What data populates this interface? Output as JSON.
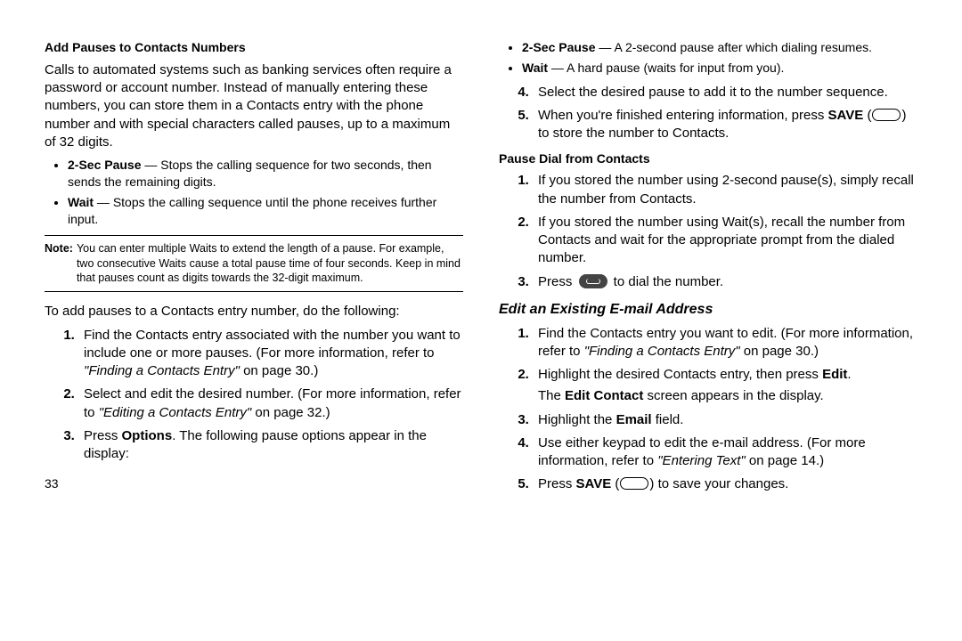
{
  "left": {
    "h1": "Add Pauses to Contacts Numbers",
    "intro": "Calls to automated systems such as banking services often require a password or account number. Instead of manually entering these numbers, you can store them in a Contacts entry with the phone number and with special characters called pauses, up to a maximum of 32 digits.",
    "bullets": [
      {
        "label": "2-Sec Pause",
        "text": " — Stops the calling sequence for two seconds, then sends the remaining digits."
      },
      {
        "label": "Wait",
        "text": " — Stops the calling sequence until the phone receives further input."
      }
    ],
    "note_label": "Note:",
    "note_text": "You can enter multiple Waits to extend the length of a pause. For example, two consecutive Waits cause a total pause time of four seconds. Keep in mind that pauses count as digits towards the 32-digit maximum.",
    "lead": "To add pauses to a Contacts entry number, do the following:",
    "steps": {
      "s1a": "Find the Contacts entry associated with the number you want to include one or more pauses. (For more information, refer to ",
      "s1ref": "\"Finding a Contacts Entry\"",
      "s1b": " on page 30.)",
      "s2a": "Select and edit the desired number. (For more information, refer to ",
      "s2ref": "\"Editing a Contacts Entry\"",
      "s2b": " on page 32.)",
      "s3a": "Press ",
      "s3bold": "Options",
      "s3b": ". The following pause options appear in the display:"
    },
    "page_num": "33"
  },
  "right": {
    "top_bullets": [
      {
        "label": "2-Sec Pause",
        "text": " — A 2-second pause after which dialing resumes."
      },
      {
        "label": "Wait",
        "text": " — A hard pause (waits for input from you)."
      }
    ],
    "step4": "Select the desired pause to add it to the number sequence.",
    "step5a": "When you're finished entering information, press ",
    "step5bold": "SAVE",
    "step5b": " (",
    "step5c": ") to store the number to Contacts.",
    "h2": "Pause Dial from Contacts",
    "pd_steps": {
      "s1": "If you stored the number using 2-second pause(s), simply recall the number from Contacts.",
      "s2": "If you stored the number using Wait(s), recall the number from Contacts and wait for the appropriate prompt from the dialed number.",
      "s3a": "Press ",
      "s3b": " to dial the number."
    },
    "h3": "Edit an Existing E-mail Address",
    "em_steps": {
      "s1a": "Find the Contacts entry you want to edit. (For more information, refer to ",
      "s1ref": "\"Finding a Contacts Entry\"",
      "s1b": " on page 30.)",
      "s2a": "Highlight the desired Contacts entry, then press ",
      "s2bold": "Edit",
      "s2b": ".",
      "s2c_a": "The ",
      "s2c_bold": "Edit Contact",
      "s2c_b": " screen appears in the display.",
      "s3a": "Highlight the ",
      "s3bold": "Email",
      "s3b": " field.",
      "s4a": "Use either keypad to edit the e-mail address. (For more information, refer to ",
      "s4ref": "\"Entering Text\"",
      "s4b": " on page 14.)",
      "s5a": "Press ",
      "s5bold": "SAVE",
      "s5b": " (",
      "s5c": ") to save your changes."
    }
  }
}
